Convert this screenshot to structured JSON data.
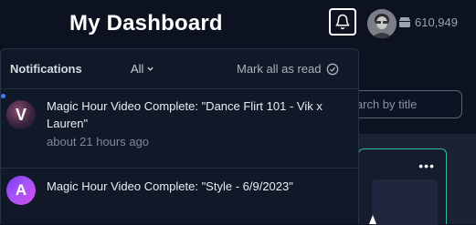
{
  "header": {
    "title": "My Dashboard",
    "credits": "610,949"
  },
  "background": {
    "search_placeholder": "Search by title"
  },
  "notifications": {
    "heading": "Notifications",
    "filter_label": "All",
    "mark_all_label": "Mark all as read",
    "items": [
      {
        "avatar_letter": "V",
        "text": "Magic Hour Video Complete: \"Dance Flirt 101 - Vik x Lauren\"",
        "time": "about 21 hours ago",
        "unread": true
      },
      {
        "avatar_letter": "A",
        "text": "Magic Hour Video Complete: \"Style - 6/9/2023\"",
        "time": "",
        "unread": false
      }
    ]
  },
  "colors": {
    "background": "#0c1220",
    "dropdown": "#111827",
    "unread_dot": "#3b82f6",
    "card_border": "#2fb7a6"
  }
}
